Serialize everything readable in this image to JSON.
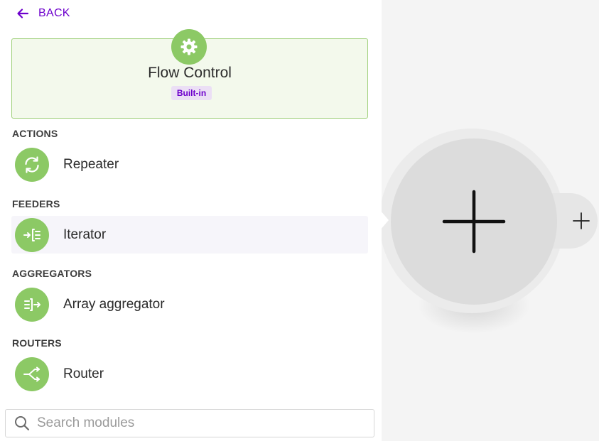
{
  "nav": {
    "back_label": "BACK"
  },
  "app": {
    "title": "Flow Control",
    "badge": "Built-in",
    "icon": "gear-icon"
  },
  "sections": [
    {
      "heading": "ACTIONS",
      "items": [
        {
          "label": "Repeater",
          "icon": "repeat-icon"
        }
      ]
    },
    {
      "heading": "FEEDERS",
      "items": [
        {
          "label": "Iterator",
          "icon": "iterator-icon"
        }
      ]
    },
    {
      "heading": "AGGREGATORS",
      "items": [
        {
          "label": "Array aggregator",
          "icon": "aggregator-icon"
        }
      ]
    },
    {
      "heading": "ROUTERS",
      "items": [
        {
          "label": "Router",
          "icon": "router-icon"
        }
      ]
    }
  ],
  "search": {
    "placeholder": "Search modules",
    "value": ""
  },
  "colors": {
    "accent": "#6d00cc",
    "module_green": "#8cc965",
    "card_bg": "#f3f9ec",
    "card_border": "#9fd07a",
    "badge_bg": "#ebdff5"
  }
}
